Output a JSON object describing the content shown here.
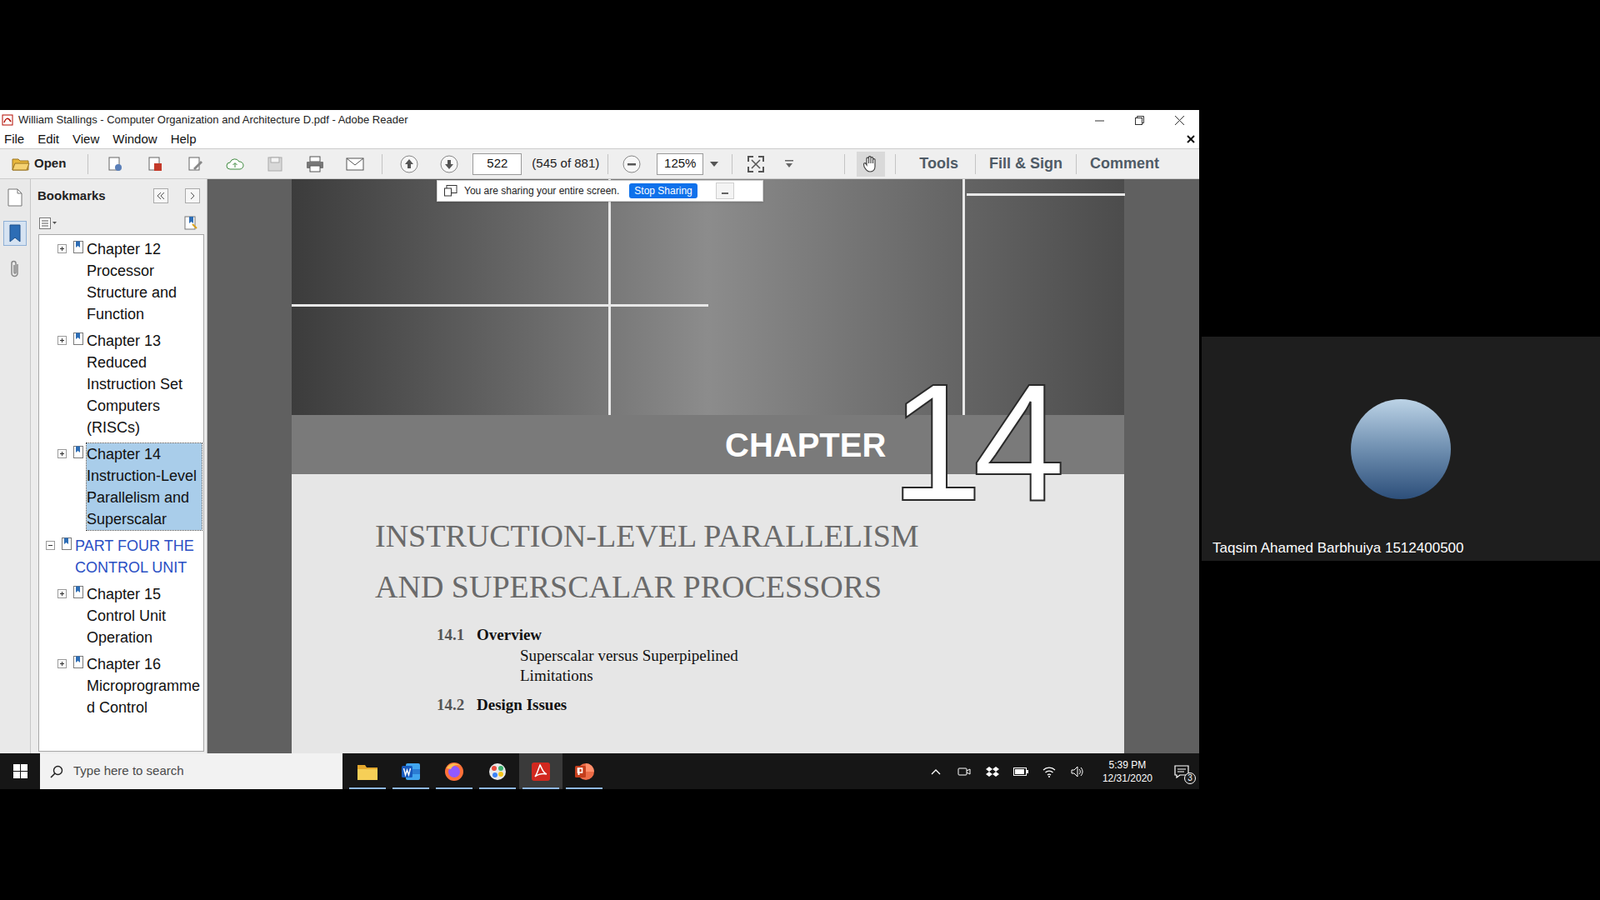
{
  "window": {
    "title": "William Stallings - Computer Organization and Architecture D.pdf - Adobe Reader"
  },
  "menu": {
    "items": [
      "File",
      "Edit",
      "View",
      "Window",
      "Help"
    ]
  },
  "toolbar": {
    "open": "Open",
    "page": "522",
    "page_count": "(545 of 881)",
    "zoom": "125%",
    "hand_tool_selected": true,
    "tools": "Tools",
    "fill_sign": "Fill & Sign",
    "comment": "Comment"
  },
  "share_banner": {
    "text": "You are sharing your entire screen.",
    "stop": "Stop Sharing"
  },
  "bookmarks": {
    "title": "Bookmarks",
    "items": [
      {
        "label": "Chapter 12 Processor Structure and Function",
        "kind": "chapter",
        "expanded": false,
        "selected": false
      },
      {
        "label": "Chapter 13 Reduced Instruction Set Computers (RISCs)",
        "kind": "chapter",
        "expanded": false,
        "selected": false
      },
      {
        "label": "Chapter 14 Instruction-Level Parallelism and Superscalar",
        "kind": "chapter",
        "expanded": false,
        "selected": true
      },
      {
        "label": "PART FOUR THE CONTROL UNIT",
        "kind": "part",
        "expanded": true,
        "selected": false
      },
      {
        "label": "Chapter 15 Control Unit Operation",
        "kind": "chapter",
        "expanded": false,
        "selected": false
      },
      {
        "label": "Chapter 16 Microprogrammed Control",
        "kind": "chapter",
        "expanded": false,
        "selected": false
      }
    ]
  },
  "document": {
    "chapter_label": "CHAPTER",
    "chapter_number": "14",
    "title_lines": [
      "INSTRUCTION-LEVEL PARALLELISM",
      "AND SUPERSCALAR PROCESSORS"
    ],
    "toc": [
      {
        "number": "14.1",
        "title": "Overview",
        "subsections": [
          "Superscalar versus Superpipelined",
          "Limitations"
        ]
      },
      {
        "number": "14.2",
        "title": "Design Issues",
        "subsections": []
      }
    ]
  },
  "taskbar": {
    "search_placeholder": "Type here to search",
    "apps": [
      {
        "kind": "explorer",
        "focused": false
      },
      {
        "kind": "word",
        "focused": false
      },
      {
        "kind": "firefox",
        "focused": false
      },
      {
        "kind": "paint",
        "focused": false
      },
      {
        "kind": "acrobat",
        "focused": true
      },
      {
        "kind": "powerpoint",
        "focused": false
      }
    ],
    "time": "5:39 PM",
    "date": "12/31/2020",
    "notifications": "3"
  },
  "participant": {
    "name": "Taqsim Ahamed Barbhuiya 1512400500"
  }
}
